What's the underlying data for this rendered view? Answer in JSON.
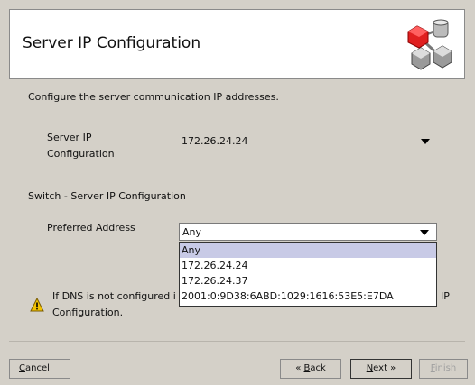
{
  "header": {
    "title": "Server IP Configuration"
  },
  "intro": "Configure the server communication IP addresses.",
  "server_ip": {
    "label_line1": "Server IP",
    "label_line2": "Configuration",
    "value": "172.26.24.24"
  },
  "switch_section": "Switch - Server IP Configuration",
  "preferred": {
    "label": "Preferred Address",
    "value": "Any",
    "options": [
      "Any",
      "172.26.24.24",
      "172.26.24.37",
      "2001:0:9D38:6ABD:1029:1616:53E5:E7DA"
    ]
  },
  "warning": {
    "line1_start": "If DNS is not configured i",
    "line1_end": "IP",
    "line2": "Configuration."
  },
  "buttons": {
    "cancel_u": "C",
    "cancel_rest": "ancel",
    "back_prefix": "« ",
    "back_u": "B",
    "back_rest": "ack",
    "next_u": "N",
    "next_rest": "ext »",
    "finish_u": "F",
    "finish_rest": "inish"
  }
}
